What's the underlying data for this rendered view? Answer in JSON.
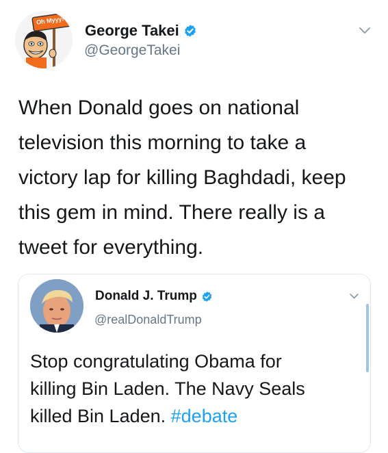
{
  "tweet": {
    "author_name": "George Takei",
    "author_handle": "@GeorgeTakei",
    "avatar_sign_text": "Oh Myyy!",
    "body_lines": [
      "When Donald goes on national",
      "television this morning to take a",
      "victory lap for killing Baghdadi, keep",
      "this gem in mind. There really is a",
      "tweet for everything."
    ]
  },
  "quoted_tweet": {
    "author_name": "Donald J. Trump",
    "author_handle": "@realDonaldTrump",
    "body_line_1": "Stop congratulating Obama for",
    "body_line_2": "killing Bin Laden. The Navy Seals",
    "body_line_3_text": "killed Bin Laden. ",
    "hashtag": "#debate"
  },
  "colors": {
    "verified": "#1da1f2",
    "hashtag": "#1da1f2",
    "handle": "#657786",
    "border": "#e1e8ed"
  },
  "icons": [
    "verified-badge-icon",
    "chevron-down-icon"
  ]
}
